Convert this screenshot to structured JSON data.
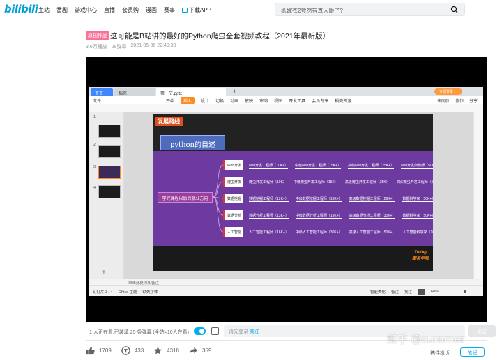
{
  "header": {
    "logo": "bilibili",
    "nav": [
      "主站",
      "番剧",
      "游戏中心",
      "直播",
      "会员购",
      "漫画",
      "赛事"
    ],
    "download": "下载APP",
    "search_placeholder": "纸嫁衣2竟然有真人版了?"
  },
  "video": {
    "tag": "原创作品",
    "title": "这可能是B站讲的最好的Python爬虫全套视频教程（2021年最新版）",
    "views": "3.6万播放",
    "danmaku": "28弹幕",
    "date": "2021-05-06 22:40:30"
  },
  "wps": {
    "tabs": [
      "首页",
      "稻壳",
      "第一节.pptx"
    ],
    "login": "立即登录",
    "file_menu": "文件",
    "menus": [
      "开始",
      "插入",
      "设计",
      "切换",
      "动画",
      "放映",
      "审阅",
      "视图",
      "开发工具",
      "会员专享",
      "稻壳资源"
    ],
    "selected_menu": "插入",
    "right_menus": [
      "未同步",
      "协作",
      "分享"
    ],
    "slide_numbers": [
      "1",
      "2",
      "3",
      "4"
    ],
    "notes_placeholder": "单击此处添加备注",
    "status_left": [
      "幻灯片 3 / 4",
      "Office 主题",
      "缺失字体"
    ],
    "status_right": [
      "智能美化",
      "备注",
      "批注"
    ],
    "zoom": "68%",
    "slide": {
      "header": "发展路线",
      "subheader": "python的自述",
      "center": "学完课程以后的就业方向",
      "categories": [
        "Web开发",
        "爬虫开发",
        "数据挖掘",
        "数据分析",
        "人工智能"
      ],
      "rows": [
        [
          "web开发工程师（10K+）",
          "中级web开发工程师（15K+）",
          "高级web开发工程师（25K+）",
          "web开发架构师（50K）"
        ],
        [
          "爬虫开发工程师（10K）",
          "中级爬虫开发工程师（15K）",
          "高级爬虫开发工程师（25K）",
          "资深爬虫开发工程师（50K）"
        ],
        [
          "数据挖掘工程师（12K+）",
          "中级数据挖掘工程师（18K+）",
          "高级数据挖掘工程师（26K+）",
          "数据科学家（50K+）"
        ],
        [
          "数据分析工程师（13K+）",
          "中级数据分析工程师（19K+）",
          "高级数据分析工程师（30K+）",
          "数据科学家（50K+）"
        ],
        [
          "人工智能工程师（16K+）",
          "中级人工智能工程师（30K+）",
          "高级人工智能工程师（50K+）",
          "人工智能科学家（100K+）"
        ]
      ],
      "brand": "Tuling",
      "brand_sub": "图灵学院"
    }
  },
  "danmaku_bar": {
    "viewers": "1 人正在看,已装填 25 条弹幕",
    "viewers_note": "(全站<10人在看)",
    "placeholder": "请先登录",
    "placeholder_link": "或注",
    "send": "发送"
  },
  "actions": [
    {
      "icon": "like-icon",
      "count": "1709"
    },
    {
      "icon": "coin-icon",
      "count": "433"
    },
    {
      "icon": "star-icon",
      "count": "4318"
    },
    {
      "icon": "share-icon",
      "count": "359"
    }
  ],
  "report": "稿件投诉",
  "note": "笔记",
  "watermark": "知乎 @summer"
}
